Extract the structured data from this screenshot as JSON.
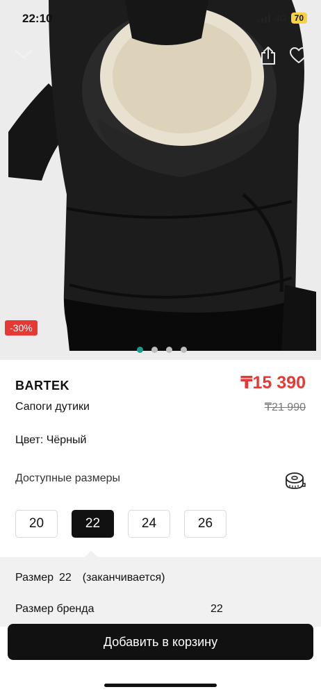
{
  "status_bar": {
    "time": "22:10",
    "network": "4G",
    "battery": "70"
  },
  "hero": {
    "discount": "-30%",
    "dots_count": 4,
    "active_dot": 0
  },
  "product": {
    "brand": "BARTEK",
    "price": "₸15 390",
    "old_price": "₸21 990",
    "name": "Сапоги дутики",
    "color_label": "Цвет: Чёрный"
  },
  "sizes": {
    "title": "Доступные размеры",
    "options": [
      "20",
      "22",
      "24",
      "26"
    ],
    "selected": "22"
  },
  "size_details": {
    "size_label": "Размер",
    "size_value": "22",
    "size_status": "(заканчивается)",
    "brand_size_label": "Размер бренда",
    "brand_size_value": "22"
  },
  "cart": {
    "button_label": "Добавить в корзину"
  },
  "colors": {
    "accent_red": "#e53935",
    "active_dot": "#1a9c8a",
    "battery": "#f7d046"
  }
}
